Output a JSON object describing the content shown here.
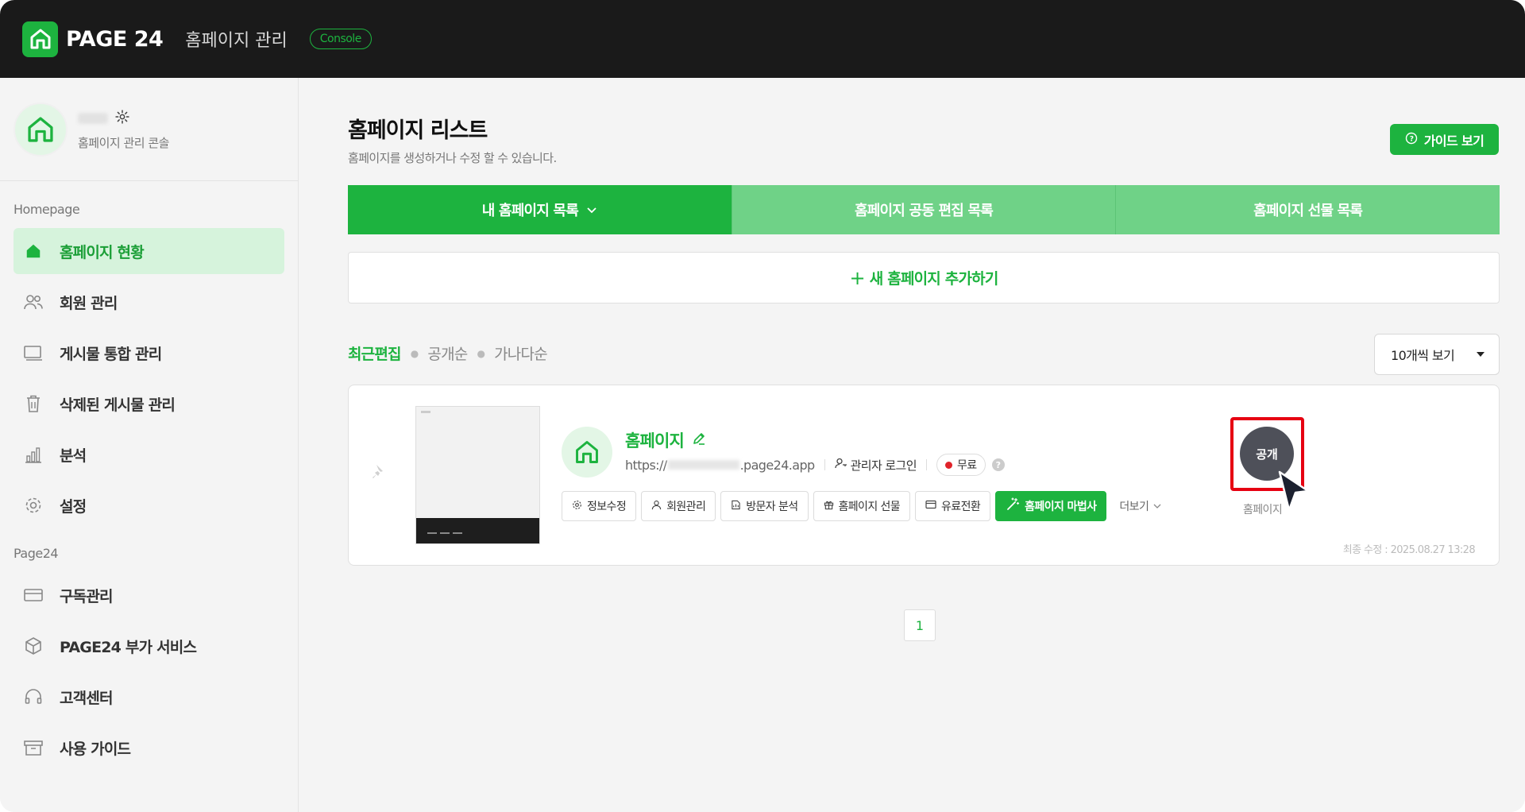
{
  "topbar": {
    "logo_text": "PAGE 24",
    "title": "홈페이지 관리",
    "badge": "Console",
    "brand_color": "#1db33f"
  },
  "sidebar": {
    "profile_subtitle": "홈페이지 관리 콘솔",
    "section_homepage": "Homepage",
    "homepage_items": [
      {
        "label": "홈페이지 현황",
        "icon": "home-icon",
        "active": true
      },
      {
        "label": "회원 관리",
        "icon": "users-icon",
        "active": false
      },
      {
        "label": "게시물 통합 관리",
        "icon": "monitor-icon",
        "active": false
      },
      {
        "label": "삭제된 게시물 관리",
        "icon": "trash-icon",
        "active": false
      },
      {
        "label": "분석",
        "icon": "bar-chart-icon",
        "active": false
      },
      {
        "label": "설정",
        "icon": "gear-icon",
        "active": false
      }
    ],
    "section_page24": "Page24",
    "page24_items": [
      {
        "label": "구독관리",
        "icon": "card-icon"
      },
      {
        "label": "PAGE24 부가 서비스",
        "icon": "box-icon"
      },
      {
        "label": "고객센터",
        "icon": "headset-icon"
      },
      {
        "label": "사용 가이드",
        "icon": "archive-icon"
      }
    ]
  },
  "main": {
    "title": "홈페이지 리스트",
    "subtitle": "홈페이지를 생성하거나 수정 할 수 있습니다.",
    "guide_button": "가이드 보기",
    "tabs": [
      {
        "label": "내 홈페이지 목록",
        "active": true
      },
      {
        "label": "홈페이지 공동 편집 목록",
        "active": false
      },
      {
        "label": "홈페이지 선물 목록",
        "active": false
      }
    ],
    "add_label": "새 홈페이지 추가하기",
    "sort": {
      "options": [
        "최근편집",
        "공개순",
        "가나다순"
      ],
      "active": "최근편집"
    },
    "per_page": "10개씩 보기",
    "site": {
      "name": "홈페이지",
      "url_prefix": "https://",
      "url_suffix": ".page24.app",
      "admin_login": "관리자 로그인",
      "plan": "무료",
      "actions": [
        "정보수정",
        "회원관리",
        "방문자 분석",
        "홈페이지 선물",
        "유료전환"
      ],
      "wizard_button": "홈페이지 마법사",
      "more": "더보기",
      "status_button": "공개",
      "status_caption": "홈페이지",
      "last_edited": "최종 수정 : 2025.08.27 13:28"
    },
    "pagination": {
      "current": "1"
    }
  }
}
